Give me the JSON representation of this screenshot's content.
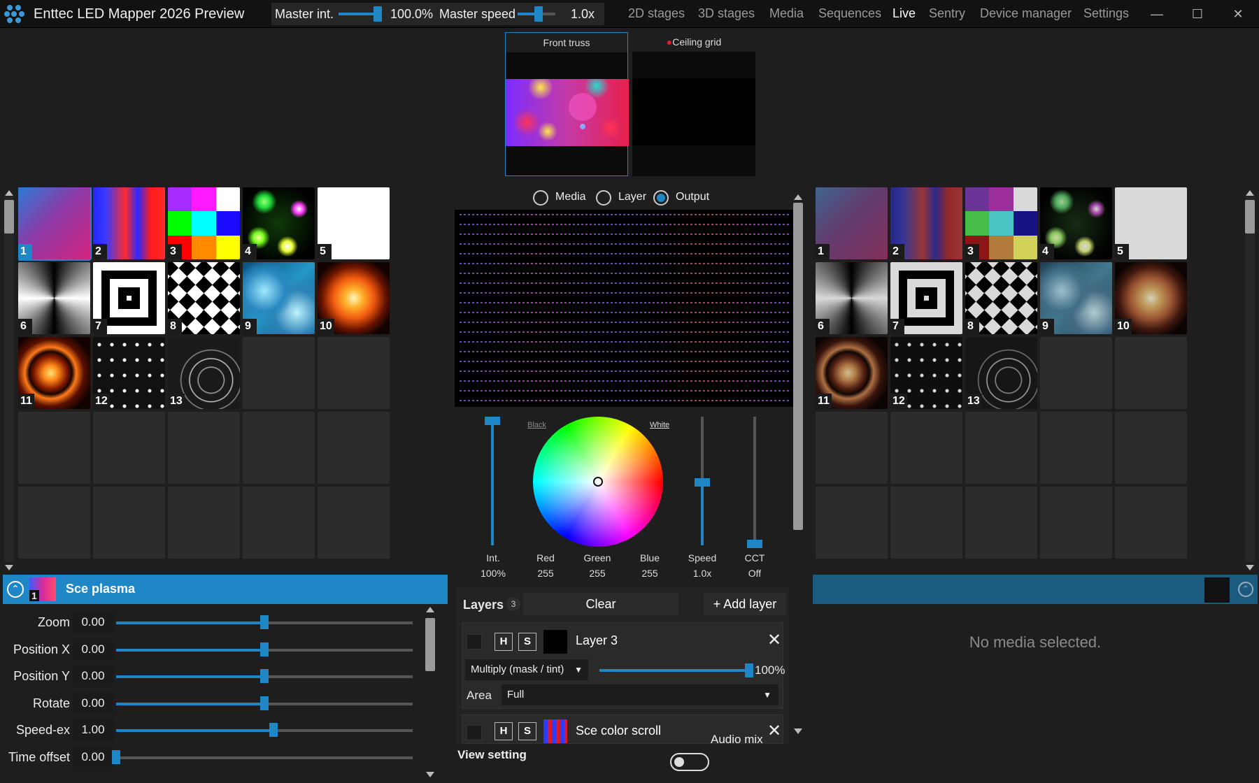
{
  "app": {
    "title": "Enttec LED Mapper 2026 Preview"
  },
  "master": {
    "intensity_label": "Master int.",
    "intensity_value": "100.0%",
    "intensity_level": 1.0,
    "speed_label": "Master speed",
    "speed_value": "1.0x",
    "speed_level": 0.5
  },
  "nav": {
    "items": [
      "2D stages",
      "3D stages",
      "Media",
      "Sequences",
      "Live",
      "Sentry",
      "Device manager",
      "Settings"
    ],
    "active": "Live"
  },
  "stages": [
    {
      "label": "Front truss",
      "selected": true
    },
    {
      "label": "Ceiling grid",
      "selected": false,
      "indicator_color": "#e02020"
    }
  ],
  "media_grid": {
    "cells": [
      {
        "num": "1",
        "icon": "plasma-thumb"
      },
      {
        "num": "2",
        "icon": "color-scroll-thumb"
      },
      {
        "num": "3",
        "icon": "color-blocks-thumb"
      },
      {
        "num": "4",
        "icon": "green-dots-thumb"
      },
      {
        "num": "5",
        "icon": "white-thumb"
      },
      {
        "num": "6",
        "icon": "radial-gradient-thumb"
      },
      {
        "num": "7",
        "icon": "concentric-squares-thumb"
      },
      {
        "num": "8",
        "icon": "diamond-pattern-thumb"
      },
      {
        "num": "9",
        "icon": "water-caustics-thumb"
      },
      {
        "num": "10",
        "icon": "explosion-thumb"
      },
      {
        "num": "11",
        "icon": "fire-spiral-thumb"
      },
      {
        "num": "12",
        "icon": "particles-thumb"
      },
      {
        "num": "13",
        "icon": "line-swirl-thumb"
      }
    ],
    "selected": "1"
  },
  "preview": {
    "radios": [
      {
        "label": "Media",
        "checked": false
      },
      {
        "label": "Layer",
        "checked": false
      },
      {
        "label": "Output",
        "checked": true
      }
    ],
    "wheel": {
      "black_label": "Black",
      "white_label": "White"
    },
    "controls": [
      {
        "label": "Int.",
        "value": "100%",
        "level": 1.0
      },
      {
        "label": "Red",
        "value": "255"
      },
      {
        "label": "Green",
        "value": "255"
      },
      {
        "label": "Blue",
        "value": "255"
      },
      {
        "label": "Speed",
        "value": "1.0x",
        "level": 0.5
      },
      {
        "label": "CCT",
        "value": "Off",
        "level": 0.0
      }
    ]
  },
  "properties": {
    "selected_num": "1",
    "title": "Sce plasma",
    "rows": [
      {
        "label": "Zoom",
        "value": "0.00",
        "level": 0.5
      },
      {
        "label": "Position X",
        "value": "0.00",
        "level": 0.5
      },
      {
        "label": "Position Y",
        "value": "0.00",
        "level": 0.5
      },
      {
        "label": "Rotate",
        "value": "0.00",
        "level": 0.5
      },
      {
        "label": "Speed-ex",
        "value": "1.00",
        "level": 0.53
      },
      {
        "label": "Time offset",
        "value": "0.00",
        "level": 0.0
      }
    ]
  },
  "layers": {
    "title": "Layers",
    "count": "3",
    "clear_label": "Clear",
    "add_label": "+ Add layer",
    "items": [
      {
        "h": "H",
        "s": "S",
        "name": "Layer 3",
        "blend": "Multiply (mask / tint)",
        "opacity": "100%",
        "opacity_level": 1.0,
        "area_label": "Area",
        "area": "Full"
      },
      {
        "h": "H",
        "s": "S",
        "name": "Sce color scroll"
      }
    ],
    "audio_mix_label": "Audio mix",
    "view_setting_label": "View setting"
  },
  "right_panel": {
    "empty_text": "No media selected."
  }
}
